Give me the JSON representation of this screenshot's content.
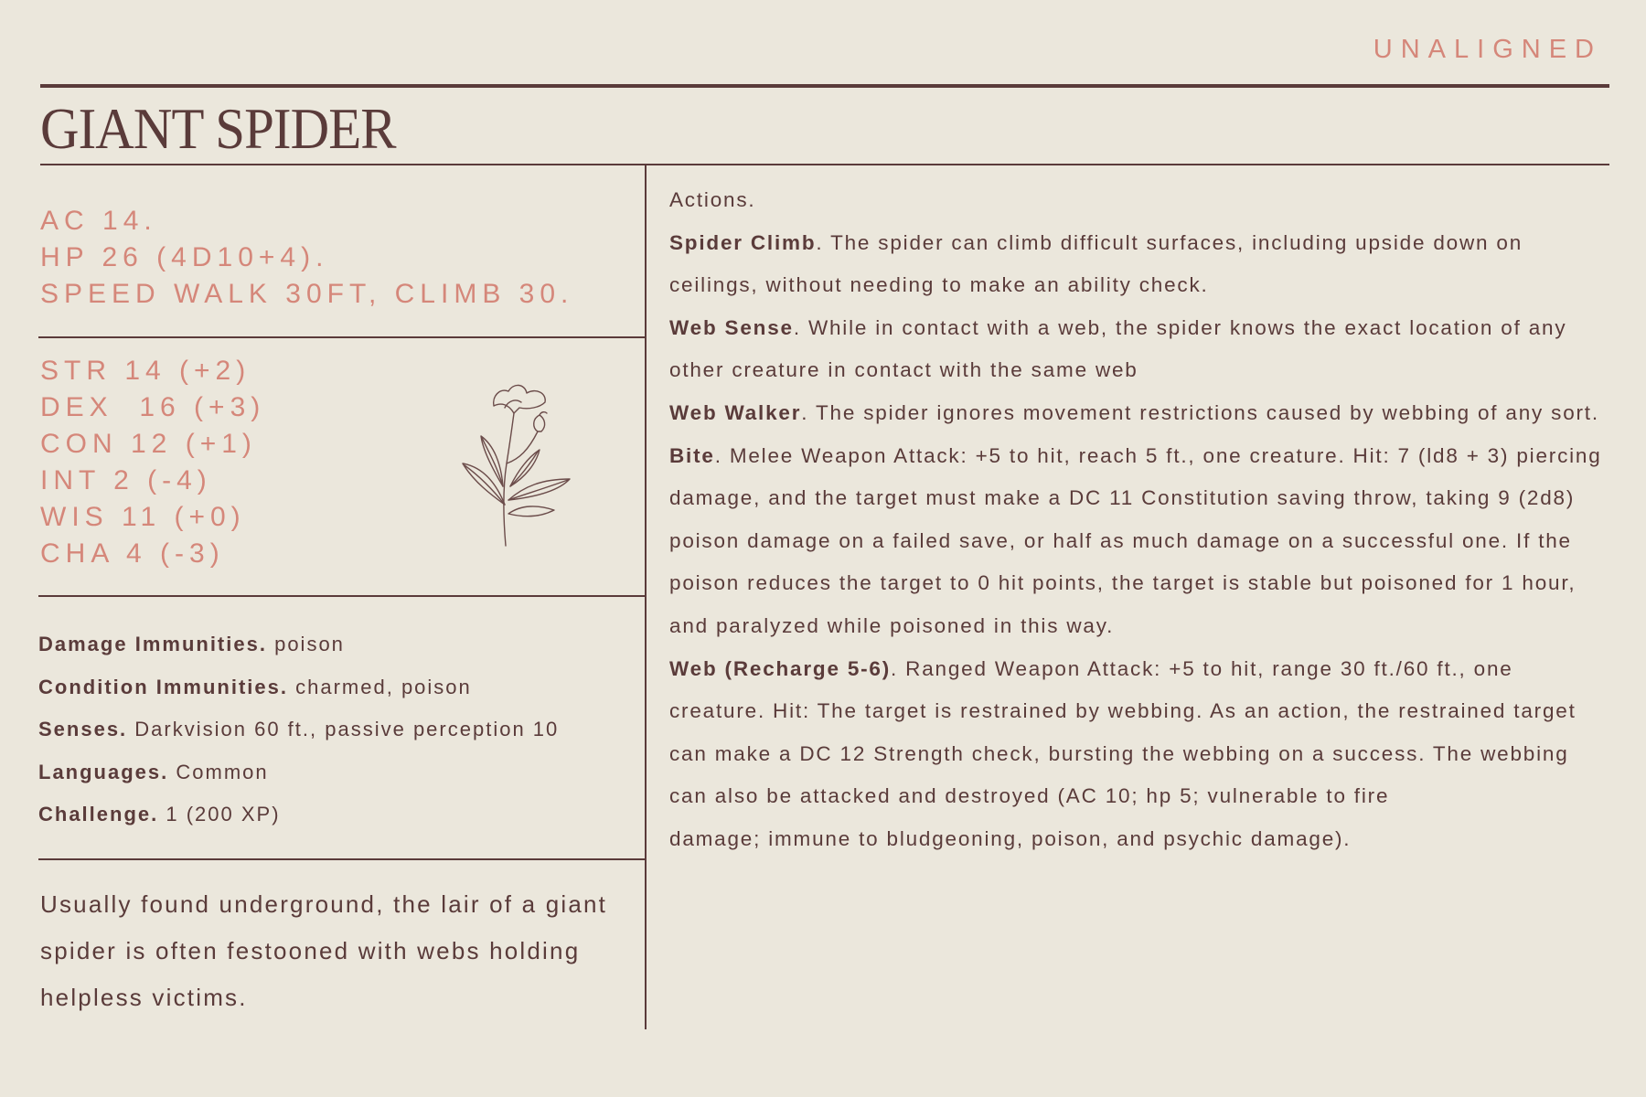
{
  "alignment": "UNALIGNED",
  "title": "GIANT SPIDER",
  "core_stats": [
    "AC 14.",
    "HP 26 (4D10+4).",
    "SPEED WALK 30FT, CLIMB 30."
  ],
  "abilities": [
    "STR 14 (+2)",
    "DEX  16 (+3)",
    "CON 12 (+1)",
    "INT 2 (-4)",
    "WIS 11 (+0)",
    "CHA 4 (-3)"
  ],
  "properties": [
    {
      "label": "Damage Immunities",
      "sep": ".",
      "value": " poison"
    },
    {
      "label": "Condition Immunities",
      "sep": ".",
      "value": " charmed, poison"
    },
    {
      "label": "Senses.",
      "sep": "",
      "value": " Darkvision 60 ft., passive perception 10"
    },
    {
      "label": "Languages",
      "sep": ".",
      "value": " Common"
    },
    {
      "label": "Challenge",
      "sep": ".",
      "value": " 1 (200 XP)"
    }
  ],
  "lore": "Usually found underground, the lair of a giant spider is often festooned with webs holding helpless victims.",
  "actions_heading": "Actions.",
  "actions": [
    {
      "name": "Spider Climb",
      "text": ". The spider can climb difficult surfaces, including upside down on ceilings, without needing to make an ability check."
    },
    {
      "name": "Web Sense",
      "text": ". While in contact with a web, the spider knows the exact location of any other creature in contact with the same web"
    },
    {
      "name": "Web Walker",
      "text": ". The spider ignores movement restrictions caused by webbing of any sort."
    },
    {
      "name": "Bite",
      "text": ". Melee Weapon Attack: +5 to hit, reach 5 ft., one creature. Hit: 7 (ld8 + 3) piercing damage, and the target must make a DC 11 Constitution saving throw, taking 9 (2d8) poison damage on a failed save, or half as much damage on a successful one. If the poison reduces the target to 0 hit points, the target is stable but poisoned for 1 hour, and paralyzed while poisoned in this way."
    },
    {
      "name": "Web (Recharge 5-6)",
      "text": ". Ranged Weapon Attack: +5 to hit, range 30 ft./60 ft., one creature. Hit: The target is restrained by webbing. As an action, the restrained target can make a DC 12 Strength check, bursting the webbing on a success. The webbing can also be attacked and destroyed (AC 10; hp 5; vulnerable to fire"
    },
    {
      "name": "",
      "text": "damage; immune to bludgeoning, poison, and psychic damage)."
    }
  ],
  "colors": {
    "background": "#ebe7dc",
    "ink": "#5a3b3a",
    "accent": "#d5877a"
  },
  "icons": {
    "illustration": "flower-sketch-icon"
  }
}
